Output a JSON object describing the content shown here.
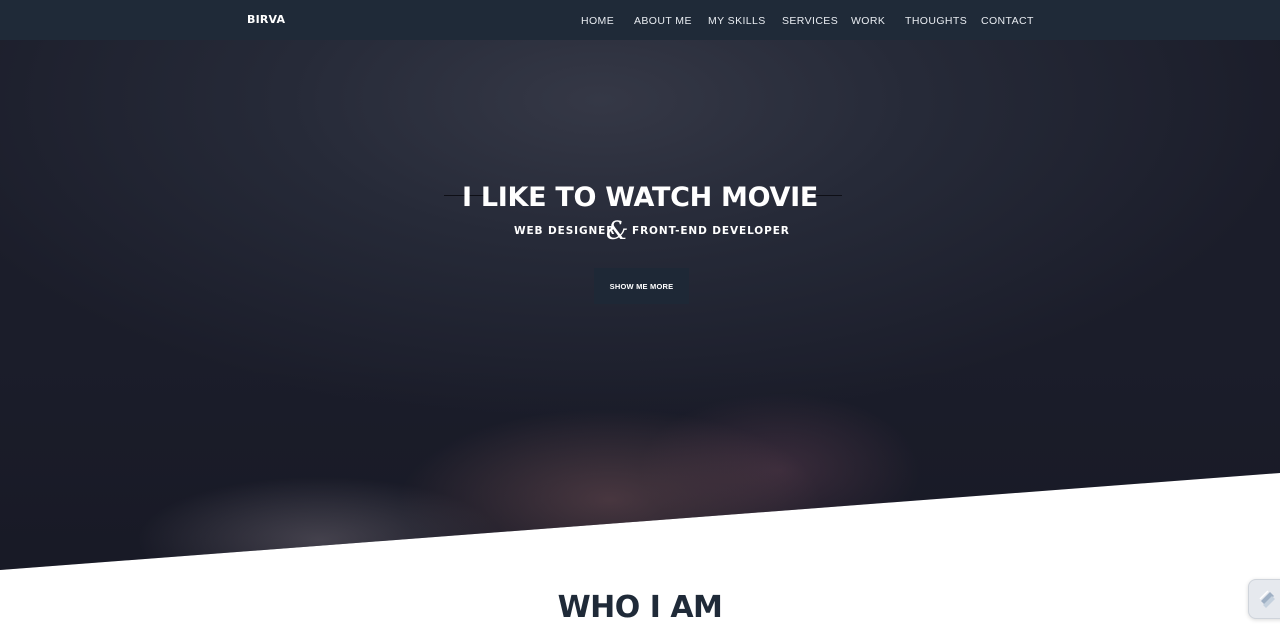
{
  "nav": {
    "brand": "BIRVA",
    "links": [
      "HOME",
      "ABOUT ME",
      "MY SKILLS",
      "SERVICES",
      "WORK",
      "THOUGHTS",
      "CONTACT"
    ]
  },
  "hero": {
    "title": "I LIKE TO WATCH MOVIE",
    "subtitle_left": "WEB DESIGNER",
    "ampersand": "&",
    "subtitle_right": "FRONT-END DEVELOPER",
    "cta_label": "SHOW ME MORE"
  },
  "about": {
    "heading": "WHO I AM"
  },
  "colors": {
    "navbar": "#1f2a38",
    "cta_bg": "#1e2836",
    "heading_text": "#1f2a38"
  },
  "icons": {
    "widget": "scroll-widget-icon"
  }
}
